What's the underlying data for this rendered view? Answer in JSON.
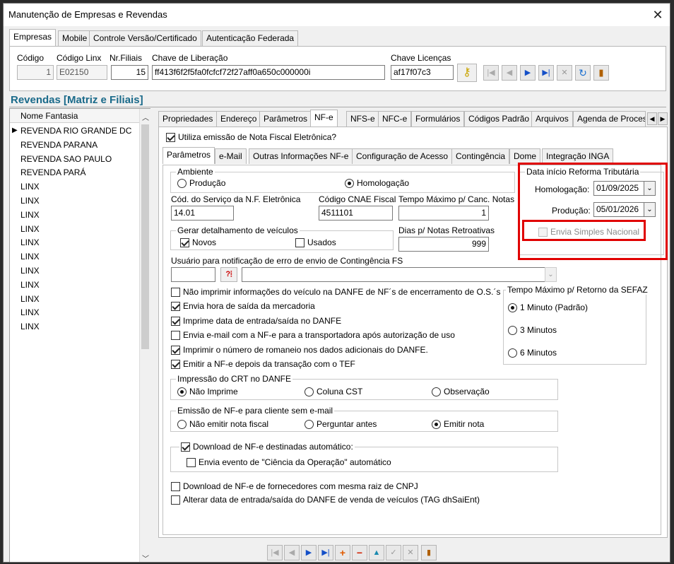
{
  "window": {
    "title": "Manutenção de Empresas e Revendas"
  },
  "top_tabs": [
    "Empresas",
    "Mobile",
    "Controle Versão/Certificado",
    "Autenticação Federada"
  ],
  "header": {
    "codigo_label": "Código",
    "codigo_value": "1",
    "codigo_linx_label": "Código Linx",
    "codigo_linx_value": "E02150",
    "nr_filiais_label": "Nr.Filiais",
    "nr_filiais_value": "15",
    "chave_liberacao_label": "Chave de Liberação",
    "chave_liberacao_value": "ff413f6f2f5fa0fcfcf72f27aff0a650c000000i",
    "chave_licencas_label": "Chave Licenças",
    "chave_licencas_value": "af17f07c3"
  },
  "revendas": {
    "title": "Revendas [Matriz e Filiais]",
    "column": "Nome Fantasia",
    "rows": [
      "REVENDA RIO GRANDE DC",
      "REVENDA PARANA",
      "REVENDA SAO PAULO",
      "REVENDA PARÁ",
      "LINX",
      "LINX",
      "LINX",
      "LINX",
      "LINX",
      "LINX",
      "LINX",
      "LINX",
      "LINX",
      "LINX",
      "LINX"
    ]
  },
  "main_tabs": [
    "Propriedades",
    "Endereço",
    "Parâmetros",
    "NF-e",
    "NFS-e",
    "NFC-e",
    "Formulários",
    "Códigos Padrão",
    "Arquivos",
    "Agenda de Proces"
  ],
  "nfe": {
    "utiliza": "Utiliza emissão de Nota Fiscal Eletrônica?",
    "sub_tabs": [
      "Parâmetros",
      "e-Mail",
      "Outras Informações NF-e",
      "Configuração de Acesso",
      "Contingência",
      "Dome",
      "Integração INGA"
    ],
    "ambiente_title": "Ambiente",
    "producao": "Produção",
    "homologacao": "Homologação",
    "cod_servico_label": "Cód. do Serviço da N.F. Eletrônica",
    "cod_servico_value": "14.01",
    "cnae_label": "Código CNAE Fiscal",
    "cnae_value": "4511101",
    "tempo_canc_label": "Tempo Máximo p/ Canc. Notas",
    "tempo_canc_value": "1",
    "veiculos_title": "Gerar detalhamento de veículos",
    "novos": "Novos",
    "usados": "Usados",
    "dias_label": "Dias p/ Notas Retroativas",
    "dias_value": "999",
    "usuario_label": "Usuário para notificação de erro de envio de Contingência FS",
    "reforma_title": "Data início Reforma Tributária",
    "homolog_date_label": "Homologação:",
    "homolog_date": "01/09/2025",
    "producao_date_label": "Produção:",
    "producao_date": "05/01/2026",
    "envia_simples": "Envia Simples Nacional",
    "options": [
      "Não imprimir informações do veículo na DANFE de NF´s de encerramento de O.S.´s",
      "Envia hora de saída da mercadoria",
      "Imprime data de entrada/saída no DANFE",
      "Envia e-mail com a NF-e para a transportadora após autorização de uso",
      "Imprimir o número de romaneio nos dados adicionais do DANFE.",
      "Emitir a NF-e depois da transação com o TEF"
    ],
    "sefaz_title": "Tempo Máximo p/ Retorno da SEFAZ",
    "sefaz_options": [
      "1 Minuto (Padrão)",
      "3 Minutos",
      "6 Minutos"
    ],
    "crt_title": "Impressão do CRT no DANFE",
    "crt_options": [
      "Não Imprime",
      "Coluna CST",
      "Observação"
    ],
    "semail_title": "Emissão de NF-e para cliente sem e-mail",
    "semail_options": [
      "Não emitir nota fiscal",
      "Perguntar antes",
      "Emitir nota"
    ],
    "download_title": "Download de NF-e destinadas automático:",
    "ciencia": "Envia evento de \"Ciência da Operação\" automático",
    "fornecedores": "Download de NF-e de fornecedores com mesma raiz de CNPJ",
    "alterar": "Alterar data de entrada/saída do DANFE de venda de veículos (TAG dhSaiEnt)"
  },
  "colors": {
    "highlight": "#e00000",
    "accent": "#1a6fa6",
    "section_title": "#1a6a8a"
  }
}
